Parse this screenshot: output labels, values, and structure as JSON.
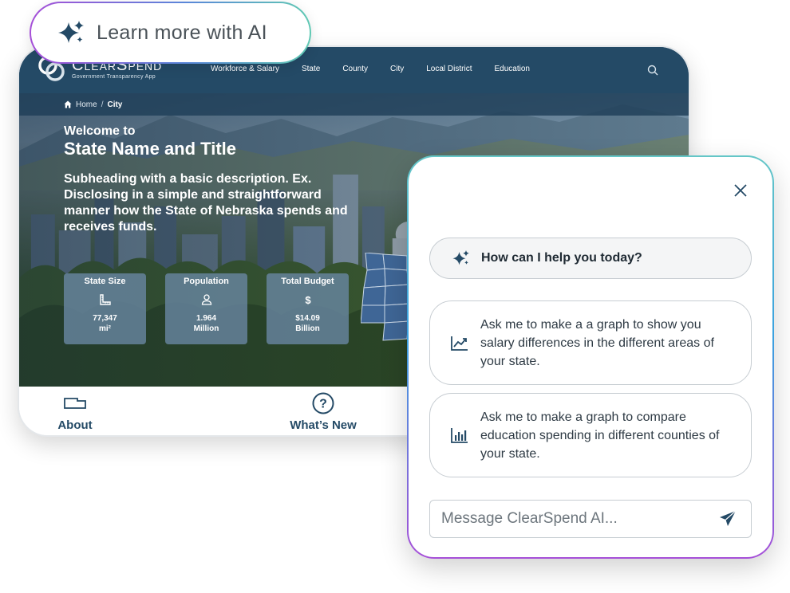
{
  "learn_more": {
    "label": "Learn more with AI",
    "icon": "sparkle-icon"
  },
  "site": {
    "logo": {
      "name": "ClearSpend",
      "tagline": "Government Transparency App"
    },
    "nav": [
      "Workforce & Salary",
      "State",
      "County",
      "City",
      "Local District",
      "Education"
    ],
    "breadcrumb": {
      "home": "Home",
      "separator": "/",
      "current": "City"
    },
    "hero": {
      "welcome": "Welcome to",
      "title": "State Name and Title",
      "subheading": "Subheading with a basic description. Ex. Disclosing in a simple and straightforward manner how the State of Nebraska spends and receives funds."
    },
    "stats": [
      {
        "label": "State Size",
        "icon": "ruler-icon",
        "value": "77,347",
        "unit": "mi²"
      },
      {
        "label": "Population",
        "icon": "person-icon",
        "value": "1.964",
        "unit": "Million"
      },
      {
        "label": "Total Budget",
        "icon": "dollar-icon",
        "value": "$14.09",
        "unit": "Billion"
      }
    ],
    "bottom_nav": [
      {
        "label": "About",
        "icon": "state-outline-icon"
      },
      {
        "label": "What’s New",
        "icon": "question-circle-icon"
      }
    ]
  },
  "chat": {
    "greeting": "How can I help you today?",
    "suggestions": [
      {
        "icon": "line-chart-icon",
        "text": "Ask me to make a a graph to show you salary differences in the different areas of your state."
      },
      {
        "icon": "bar-chart-icon",
        "text": "Ask me to make a graph to compare education spending in different counties of your state."
      }
    ],
    "input_placeholder": "Message ClearSpend AI..."
  },
  "colors": {
    "brand_navy": "#244a66",
    "accent_purple": "#a64fd8",
    "accent_teal": "#60c9b3",
    "accent_blue": "#3aa1e0"
  }
}
